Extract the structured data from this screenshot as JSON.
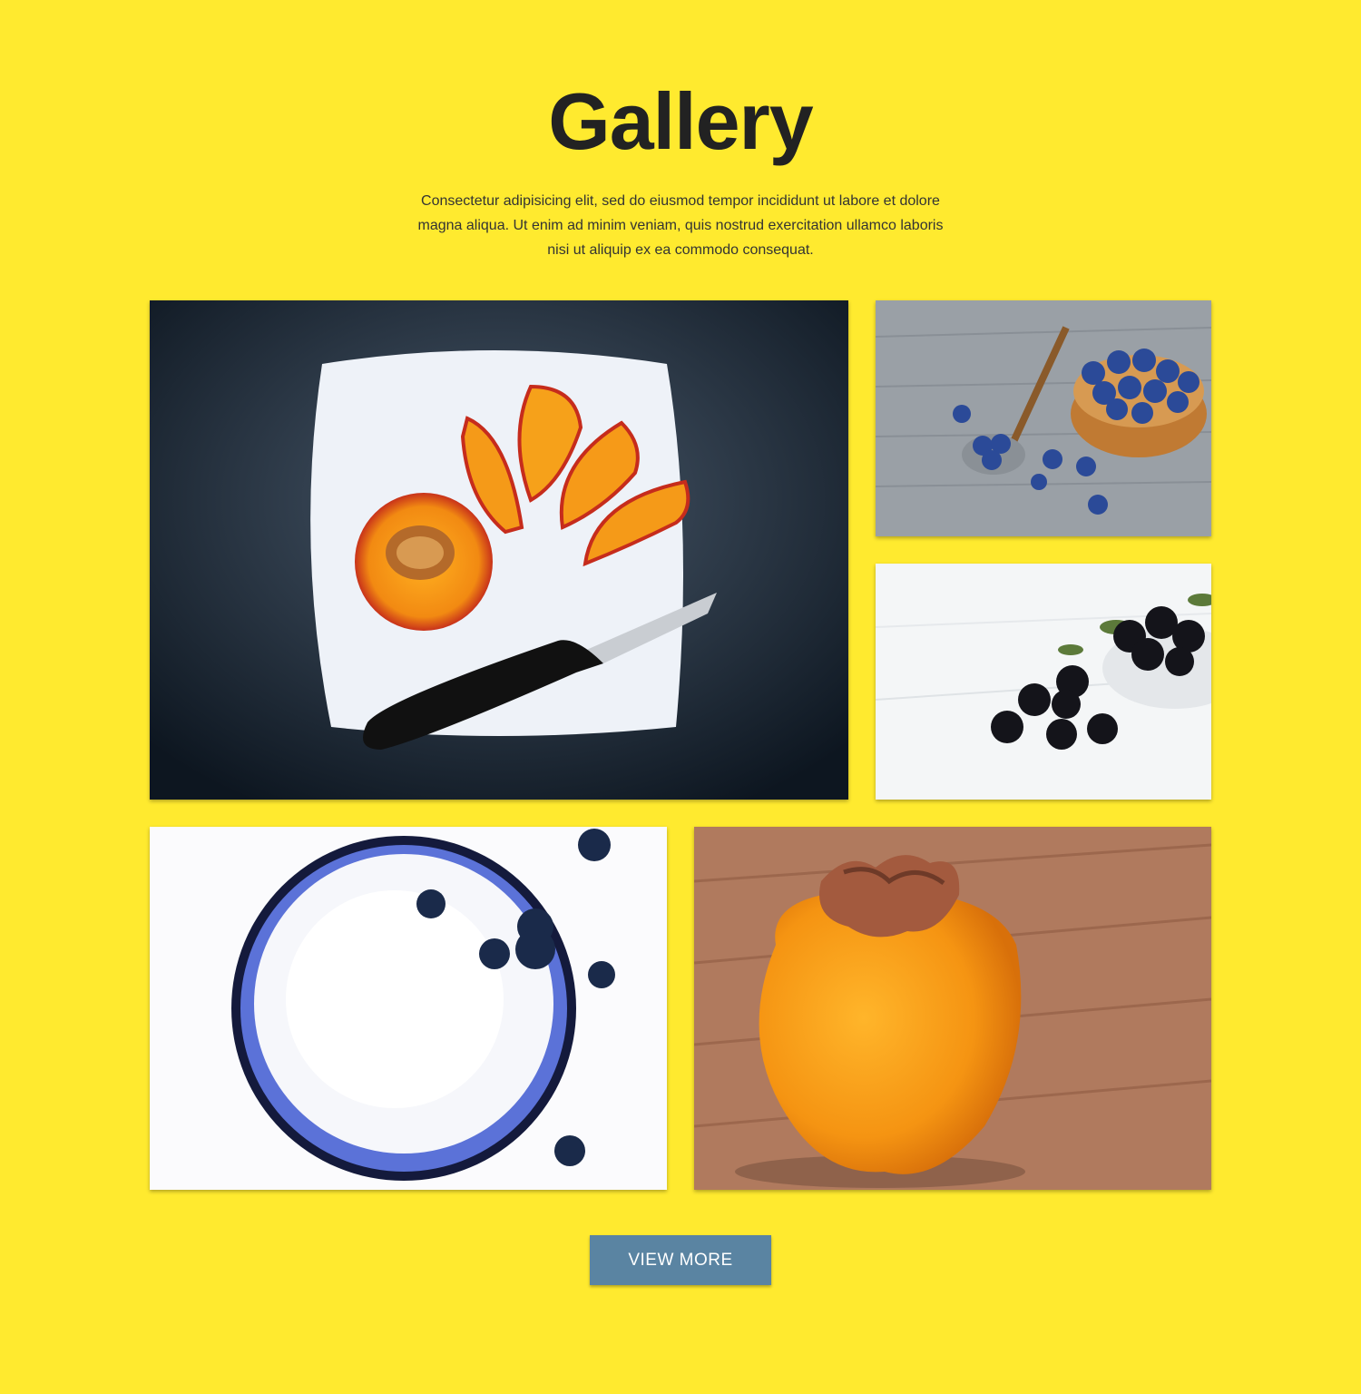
{
  "section": {
    "title": "Gallery",
    "description": "Consectetur adipisicing elit, sed do eiusmod tempor incididunt ut labore et dolore magna aliqua. Ut enim ad minim veniam, quis nostrud exercitation ullamco laboris nisi ut aliquip ex ea commodo consequat."
  },
  "gallery": {
    "images": [
      {
        "subject": "sliced peach on white plate with black knife"
      },
      {
        "subject": "blueberries in wooden bowl with spoon"
      },
      {
        "subject": "blackberries on white surface"
      },
      {
        "subject": "blueberries splashing into glass of milk"
      },
      {
        "subject": "persimmon on wooden table"
      }
    ]
  },
  "button": {
    "label": "VIEW MORE"
  },
  "colors": {
    "background": "#ffea2f",
    "button": "#5a84a2",
    "title": "#222222"
  }
}
